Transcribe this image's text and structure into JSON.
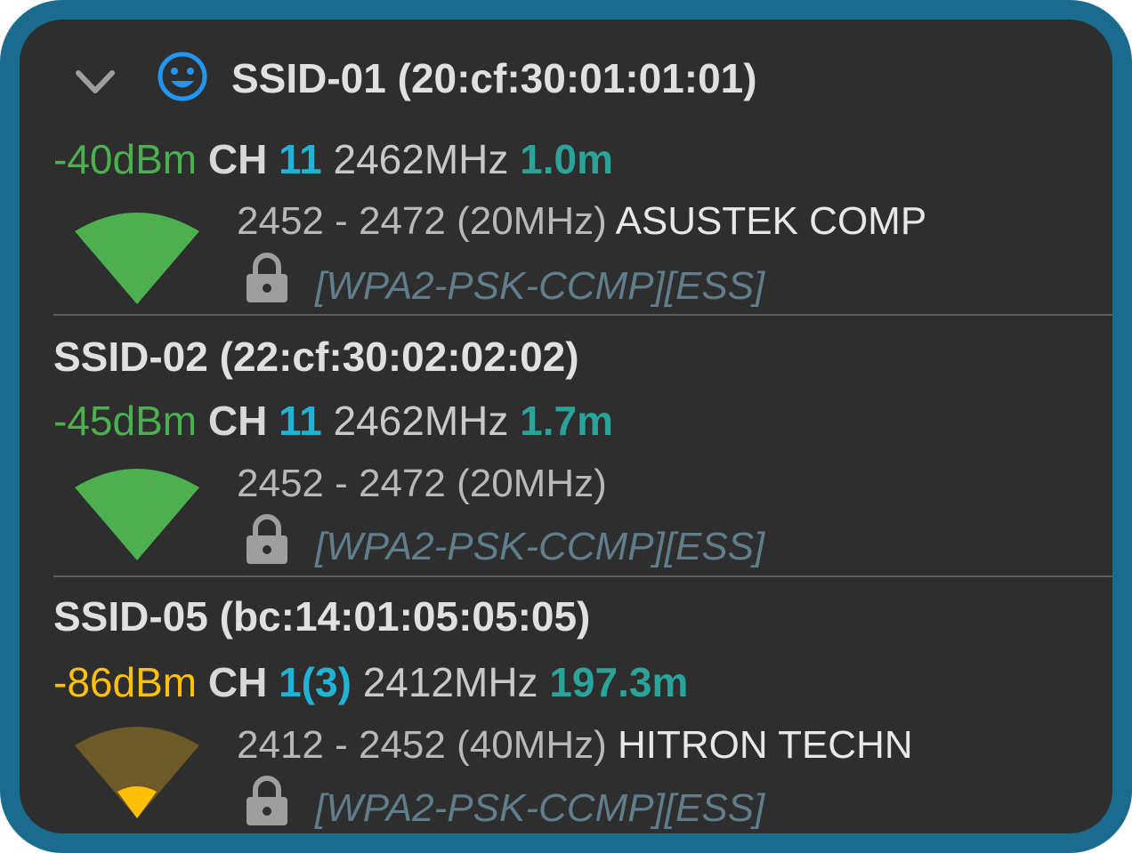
{
  "colors": {
    "border": "#1a6c8e",
    "background": "#2e2e2e",
    "good_signal": "#4caf50",
    "weak_signal": "#ffc107",
    "channel": "#21b3d6",
    "distance": "#2aa39a",
    "capabilities": "#607d8b"
  },
  "networks": [
    {
      "title": "SSID-01 (20:cf:30:01:01:01)",
      "connected": true,
      "dbm": "-40dBm",
      "dbm_color": "#4caf50",
      "ch_label": "CH",
      "channel": "11",
      "frequency": "2462MHz",
      "distance": "1.0m",
      "range": "2452 - 2472 (20MHz)",
      "vendor": "ASUSTEK COMP",
      "capabilities": "[WPA2-PSK-CCMP][ESS]",
      "signal_level": 1.0
    },
    {
      "title": "SSID-02 (22:cf:30:02:02:02)",
      "connected": false,
      "dbm": "-45dBm",
      "dbm_color": "#4caf50",
      "ch_label": "CH",
      "channel": "11",
      "frequency": "2462MHz",
      "distance": "1.7m",
      "range": "2452 - 2472 (20MHz)",
      "vendor": "",
      "capabilities": "[WPA2-PSK-CCMP][ESS]",
      "signal_level": 1.0
    },
    {
      "title": "SSID-05 (bc:14:01:05:05:05)",
      "connected": false,
      "dbm": "-86dBm",
      "dbm_color": "#ffc107",
      "ch_label": "CH",
      "channel": "1(3)",
      "frequency": "2412MHz",
      "distance": "197.3m",
      "range": "2412 - 2452 (40MHz)",
      "vendor": "HITRON TECHN",
      "capabilities": "[WPA2-PSK-CCMP][ESS]",
      "signal_level": 0.25
    }
  ]
}
